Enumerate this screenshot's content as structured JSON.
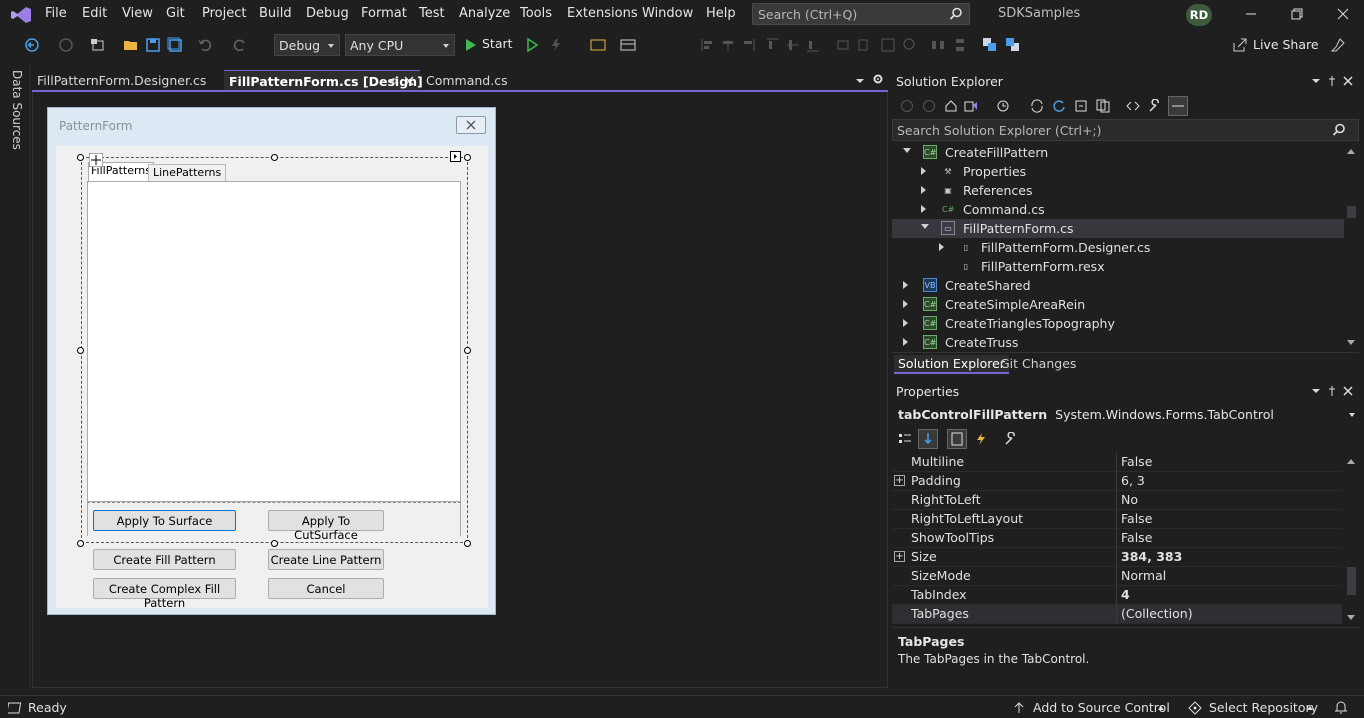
{
  "menu": {
    "items": [
      "File",
      "Edit",
      "View",
      "Git",
      "Project",
      "Build",
      "Debug",
      "Format",
      "Test",
      "Analyze",
      "Tools",
      "Extensions",
      "Window",
      "Help"
    ],
    "search_placeholder": "Search (Ctrl+Q)",
    "solution_name": "SDKSamples",
    "user_initials": "RD"
  },
  "toolbar": {
    "config": "Debug",
    "platform": "Any CPU",
    "start_label": "Start",
    "live_share_label": "Live Share"
  },
  "left_gutter": {
    "label": "Data Sources"
  },
  "doc_tabs": [
    {
      "label": "FillPatternForm.Designer.cs",
      "active": false
    },
    {
      "label": "FillPatternForm.cs [Design]",
      "active": true
    },
    {
      "label": "Command.cs",
      "active": false
    }
  ],
  "designer": {
    "form_title": "PatternForm",
    "tabs": [
      "FillPatterns",
      "LinePatterns"
    ],
    "buttons": {
      "apply_surface": "Apply To Surface",
      "apply_cut": "Apply To CutSurface",
      "create_fill": "Create Fill Pattern",
      "create_line": "Create Line Pattern",
      "create_complex": "Create Complex Fill Pattern",
      "cancel": "Cancel"
    }
  },
  "solution_explorer": {
    "title": "Solution Explorer",
    "search_placeholder": "Search Solution Explorer (Ctrl+;)",
    "tree": [
      {
        "label": "CreateFillPattern",
        "icon": "csharp-project-icon",
        "expanded": true,
        "level": 0,
        "selected": false
      },
      {
        "label": "Properties",
        "icon": "wrench-icon",
        "expanded": false,
        "level": 1,
        "selected": false
      },
      {
        "label": "References",
        "icon": "references-icon",
        "expanded": false,
        "level": 1,
        "selected": false
      },
      {
        "label": "Command.cs",
        "icon": "csharp-file-icon",
        "expanded": false,
        "level": 1,
        "selected": false
      },
      {
        "label": "FillPatternForm.cs",
        "icon": "form-icon",
        "expanded": true,
        "level": 1,
        "selected": true
      },
      {
        "label": "FillPatternForm.Designer.cs",
        "icon": "document-icon",
        "expanded": false,
        "level": 2,
        "selected": false
      },
      {
        "label": "FillPatternForm.resx",
        "icon": "document-icon",
        "expanded": null,
        "level": 2,
        "selected": false
      },
      {
        "label": "CreateShared",
        "icon": "vb-project-icon",
        "expanded": false,
        "level": 0,
        "selected": false
      },
      {
        "label": "CreateSimpleAreaRein",
        "icon": "csharp-project-icon",
        "expanded": false,
        "level": 0,
        "selected": false
      },
      {
        "label": "CreateTrianglesTopography",
        "icon": "csharp-project-icon",
        "expanded": false,
        "level": 0,
        "selected": false
      },
      {
        "label": "CreateTruss",
        "icon": "csharp-project-icon",
        "expanded": false,
        "level": 0,
        "selected": false
      }
    ],
    "bottom_tabs": [
      "Solution Explorer",
      "Git Changes"
    ]
  },
  "properties": {
    "title": "Properties",
    "object_name": "tabControlFillPattern",
    "object_type": "System.Windows.Forms.TabControl",
    "rows": [
      {
        "name": "Multiline",
        "value": "False",
        "bold": false,
        "expandable": false,
        "selected": false
      },
      {
        "name": "Padding",
        "value": "6, 3",
        "bold": false,
        "expandable": true,
        "selected": false
      },
      {
        "name": "RightToLeft",
        "value": "No",
        "bold": false,
        "expandable": false,
        "selected": false
      },
      {
        "name": "RightToLeftLayout",
        "value": "False",
        "bold": false,
        "expandable": false,
        "selected": false
      },
      {
        "name": "ShowToolTips",
        "value": "False",
        "bold": false,
        "expandable": false,
        "selected": false
      },
      {
        "name": "Size",
        "value": "384, 383",
        "bold": true,
        "expandable": true,
        "selected": false
      },
      {
        "name": "SizeMode",
        "value": "Normal",
        "bold": false,
        "expandable": false,
        "selected": false
      },
      {
        "name": "TabIndex",
        "value": "4",
        "bold": true,
        "expandable": false,
        "selected": false
      },
      {
        "name": "TabPages",
        "value": "(Collection)",
        "bold": false,
        "expandable": false,
        "selected": true
      }
    ],
    "description_title": "TabPages",
    "description_text": "The TabPages in the TabControl."
  },
  "statusbar": {
    "status": "Ready",
    "add_source": "Add to Source Control",
    "select_repo": "Select Repository"
  },
  "colors": {
    "accent": "#7c60d6",
    "background": "#1f1f1f",
    "form_bg": "#f0f0f0"
  }
}
